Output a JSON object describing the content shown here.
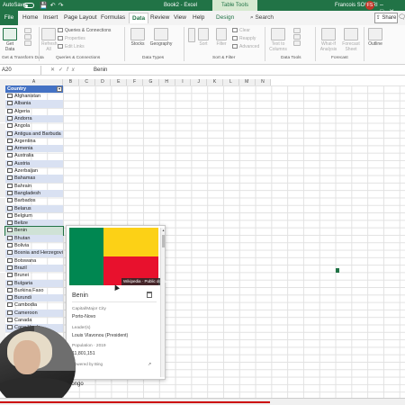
{
  "titlebar": {
    "autosave": "AutoSave",
    "document": "Book2 - Excel",
    "context_tab": "Table Tools",
    "user": "Francois SOUYRI",
    "avatar_initials": "FS",
    "accent_color": "#217346"
  },
  "tabs": [
    "File",
    "Home",
    "Insert",
    "Page Layout",
    "Formulas",
    "Data",
    "Review",
    "View",
    "Help",
    "Design"
  ],
  "active_tab": "Data",
  "search_label": "Search",
  "share_label": "Share",
  "ribbon": {
    "get_data": "Get Data",
    "refresh_all": "Refresh All",
    "queries_connections": "Queries & Connections",
    "properties": "Properties",
    "edit_links": "Edit Links",
    "stocks": "Stocks",
    "geography": "Geography",
    "sort": "Sort",
    "filter": "Filter",
    "clear": "Clear",
    "reapply": "Reapply",
    "advanced": "Advanced",
    "text_to_columns": "Text to Columns",
    "what_if": "What-If Analysis",
    "forecast_sheet": "Forecast Sheet",
    "outline": "Outline",
    "groups": {
      "get_transform": "Get & Transform Data",
      "queries": "Queries & Connections",
      "data_types": "Data Types",
      "sort_filter": "Sort & Filter",
      "data_tools": "Data Tools",
      "forecast": "Forecast"
    }
  },
  "formula_bar": {
    "name_box": "A20",
    "value": "Benin"
  },
  "columns": [
    "A",
    "B",
    "C",
    "D",
    "E",
    "F",
    "G",
    "H",
    "I",
    "J",
    "K",
    "L",
    "M",
    "N"
  ],
  "table": {
    "header": "Country",
    "rows": [
      "Afghanistan",
      "Albania",
      "Algeria",
      "Andorra",
      "Angola",
      "Antigua and Barbuda",
      "Argentina",
      "Armenia",
      "Australia",
      "Austria",
      "Azerbaijan",
      "Bahamas",
      "Bahrain",
      "Bangladesh",
      "Barbados",
      "Belarus",
      "Belgium",
      "Belize",
      "Benin",
      "Bhutan",
      "Bolivia",
      "Bosnia and Herzegovina",
      "Botswana",
      "Brazil",
      "Brunei",
      "Bulgaria",
      "Burkina Faso",
      "Burundi",
      "Cambodia",
      "Cameroon",
      "Canada",
      "Cape Verde"
    ],
    "selected": "Benin",
    "bottom_text": "o Congo"
  },
  "card": {
    "title": "Benin",
    "image_credit": "Wikipedia · Public domain",
    "capital_label": "Capital/Major City",
    "capital_value": "Porto-Novo",
    "leader_label": "Leader(s)",
    "leader_value": "Louis Vlavonou (President)",
    "population_label": "Population · 2019",
    "population_value": "11,801,151",
    "powered_by": "Powered by Bing",
    "flag_colors": [
      "#008751",
      "#fcd116",
      "#e8112d"
    ]
  }
}
